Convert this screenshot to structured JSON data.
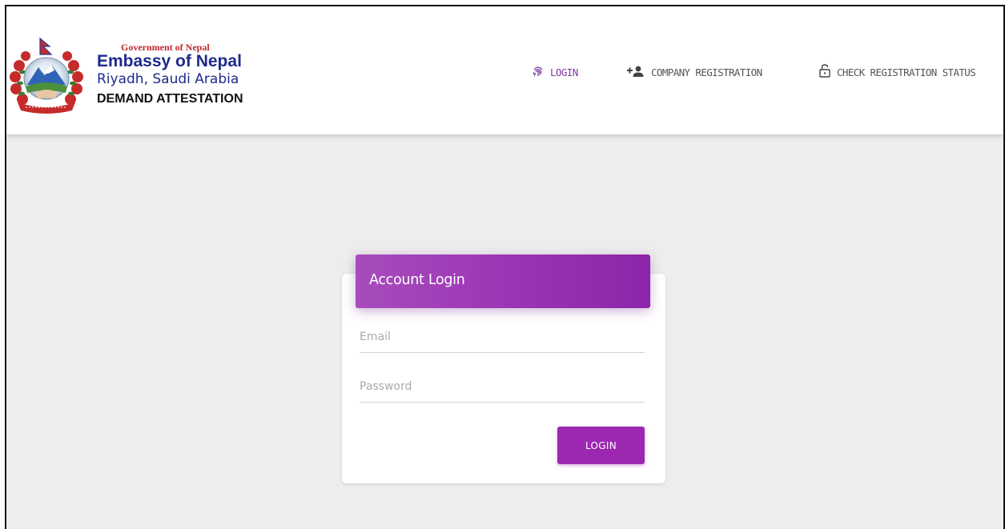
{
  "brand": {
    "government": "Government of Nepal",
    "embassy": "Embassy of Nepal",
    "city": "Riyadh, Saudi Arabia",
    "section": "DEMAND ATTESTATION"
  },
  "nav": {
    "login": {
      "label": "LOGIN",
      "icon": "fingerprint-icon"
    },
    "company_registration": {
      "label": "COMPANY REGISTRATION",
      "icon": "add-person-icon"
    },
    "check_status": {
      "label": "CHECK REGISTRATION STATUS",
      "icon": "lock-open-icon"
    }
  },
  "login_card": {
    "title": "Account Login",
    "email": {
      "placeholder": "Email",
      "value": ""
    },
    "password": {
      "placeholder": "Password",
      "value": ""
    },
    "submit_label": "LOGIN"
  },
  "colors": {
    "accent": "#9c27b0",
    "nav_active": "#7d3a9c",
    "brand_blue": "#1f2a8c",
    "brand_red": "#c0272d",
    "page_bg": "#ededed"
  }
}
